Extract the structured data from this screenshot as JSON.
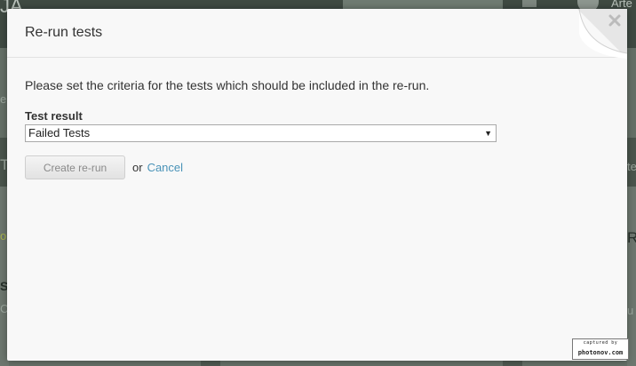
{
  "background": {
    "app_logo_fragment": "JA",
    "user_fragment": "Arte",
    "left_fragments": [
      "e",
      "To",
      "o",
      "St",
      "Cr"
    ],
    "right_fragments": [
      "te",
      "Re",
      "u"
    ]
  },
  "modal": {
    "title": "Re-run tests",
    "intro": "Please set the criteria for the tests which should be included in the re-run.",
    "test_result_label": "Test result",
    "test_result_value": "Failed Tests",
    "create_button_label": "Create re-run",
    "or_text": "or",
    "cancel_label": "Cancel",
    "close_icon": "close-icon"
  },
  "watermark": {
    "top_text": "captured by",
    "bottom_text": "photonov.com"
  },
  "colors": {
    "link": "#4a93b8",
    "modal_bg": "#f8f8f8",
    "overlay": "#5d6b60"
  }
}
